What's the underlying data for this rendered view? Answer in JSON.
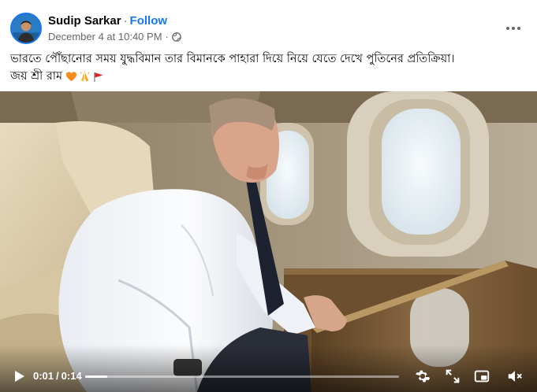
{
  "post": {
    "author": "Sudip Sarkar",
    "separator": "·",
    "follow_label": "Follow",
    "timestamp": "December 4 at 10:40 PM",
    "meta_separator": "·",
    "privacy_icon": "globe-icon",
    "caption_line1": "ভারতে পৌঁছানোর সময় যুদ্ধবিমান তার বিমানকে পাহারা দিয়ে নিয়ে যেতে দেখে পুতিনের প্রতিক্রিয়া।",
    "caption_line2": "জয় শ্রী রাম",
    "caption_emojis": [
      "orange-heart-icon",
      "folded-hands-icon",
      "triangular-flag-icon"
    ]
  },
  "video": {
    "current_time": "0:01",
    "time_separator": "/",
    "duration": "0:14",
    "progress": 0.07,
    "icons": [
      "play-icon",
      "settings-gear-icon",
      "fullscreen-icon",
      "picture-in-picture-icon",
      "volume-muted-icon"
    ]
  },
  "colors": {
    "accent": "#1877f2",
    "secondary_text": "#65676b",
    "primary_text": "#050505",
    "background": "#ffffff"
  }
}
